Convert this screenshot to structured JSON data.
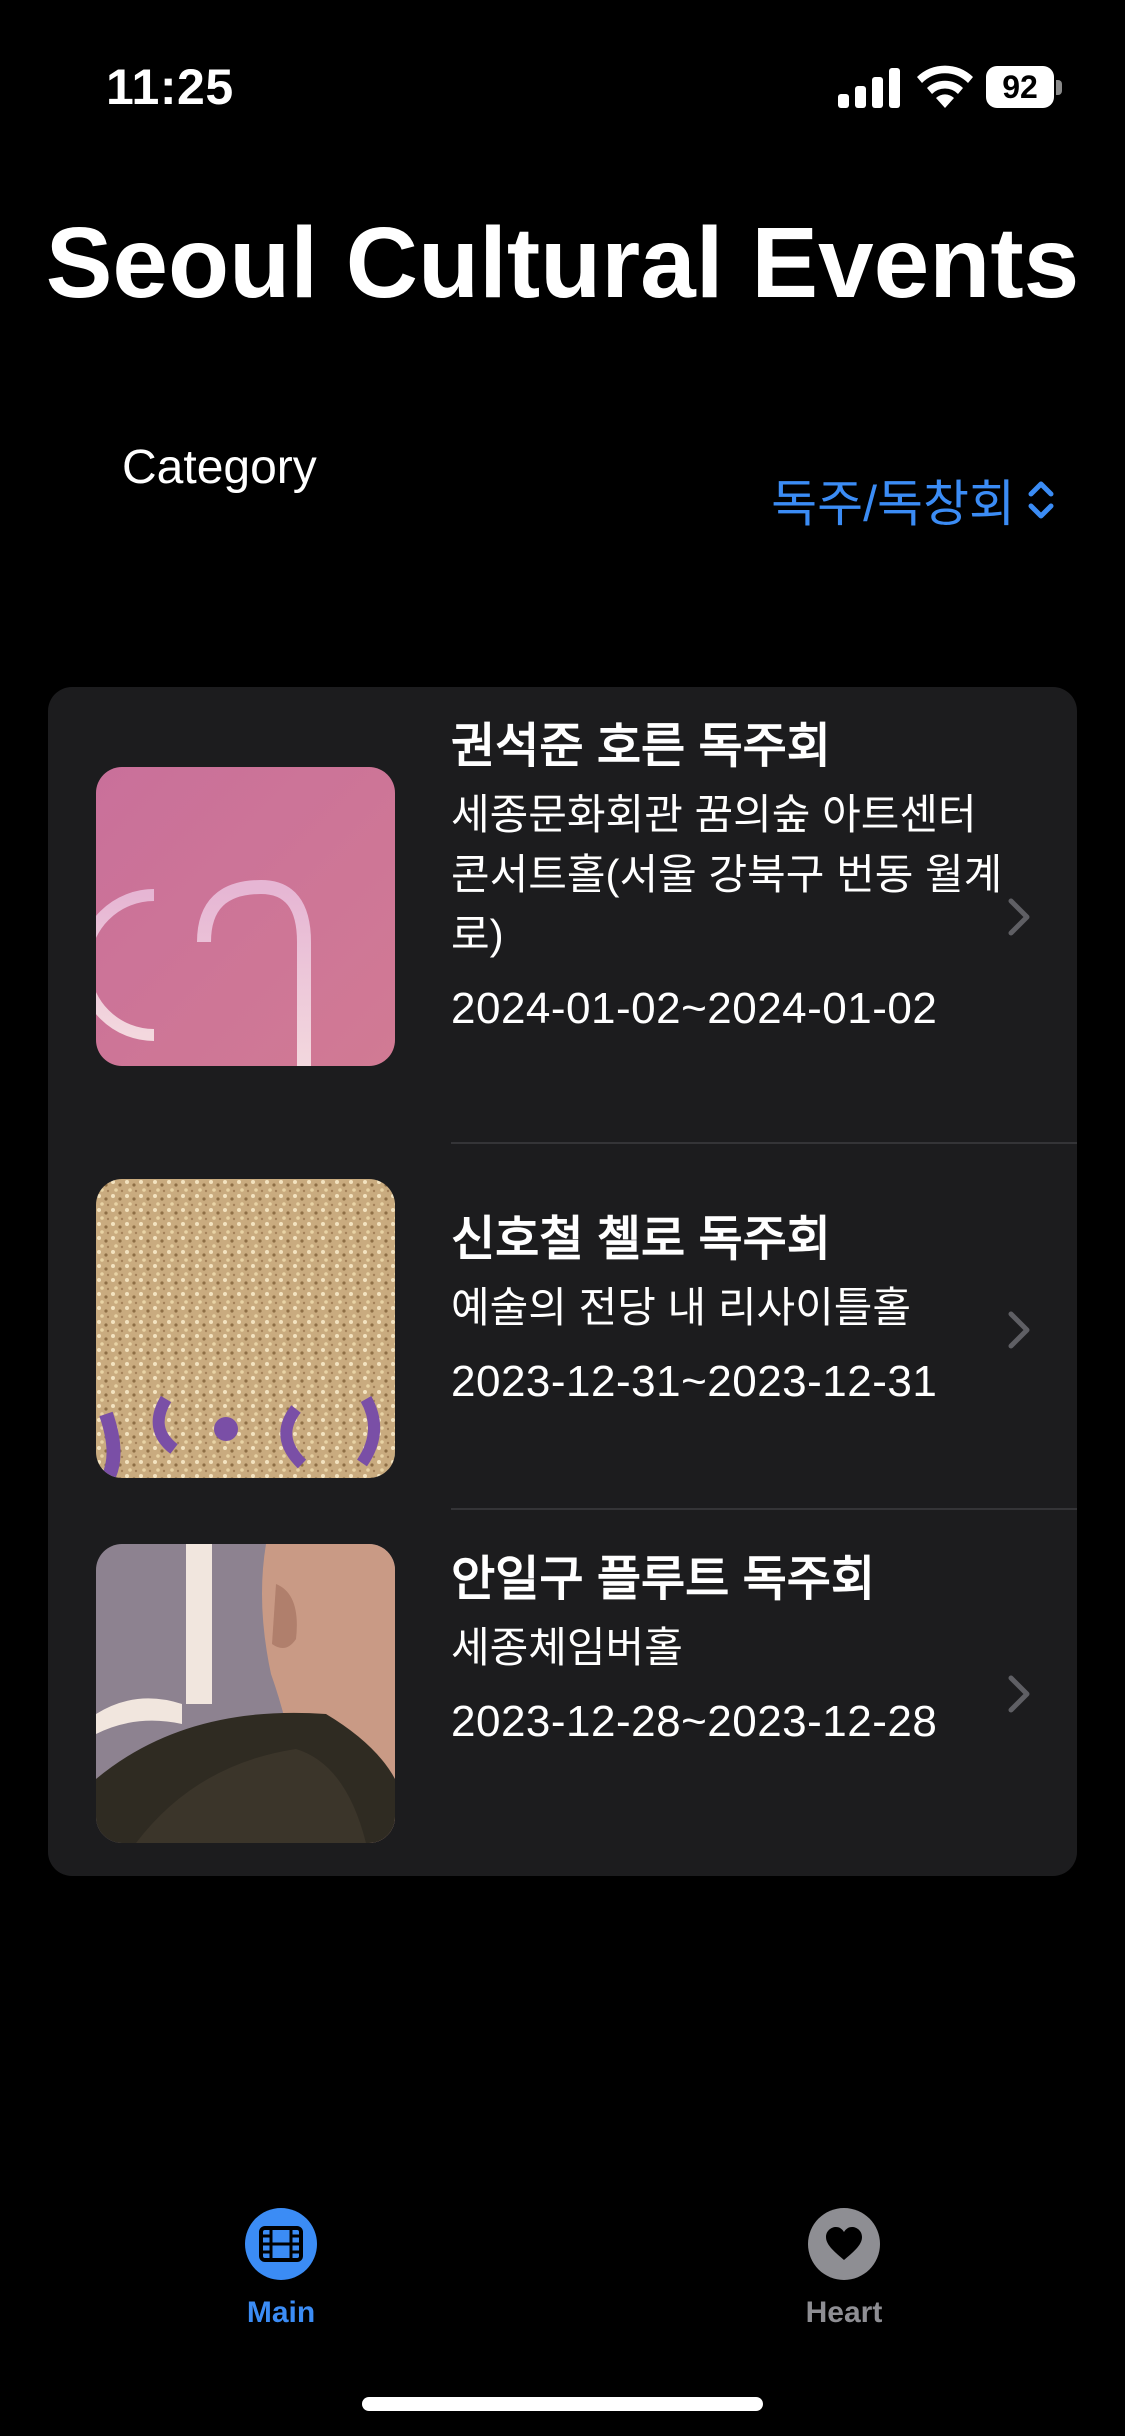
{
  "status_bar": {
    "time": "11:25",
    "battery": "92"
  },
  "header": {
    "title": "Seoul Cultural Events"
  },
  "category": {
    "label": "Category",
    "selected": "독주/독창회"
  },
  "events": [
    {
      "title": "권석준 호른 독주회",
      "venue": "세종문화회관 꿈의숲 아트센터 콘서트홀(서울 강북구 번동 월계로)",
      "date": "2024-01-02~2024-01-02",
      "thumb_icon": "poster-pink-thumbnail"
    },
    {
      "title": "신호철 첼로 독주회",
      "venue": "예술의 전당 내 리사이틀홀",
      "date": "2023-12-31~2023-12-31",
      "thumb_icon": "poster-glitter-thumbnail"
    },
    {
      "title": "안일구 플루트 독주회",
      "venue": "세종체임버홀",
      "date": "2023-12-28~2023-12-28",
      "thumb_icon": "poster-portrait-thumbnail"
    }
  ],
  "tab_bar": {
    "tabs": [
      {
        "label": "Main",
        "icon": "film-icon",
        "active": true
      },
      {
        "label": "Heart",
        "icon": "heart-icon",
        "active": false
      }
    ]
  },
  "colors": {
    "accent": "#3b8cf5",
    "inactive": "#8e8e93",
    "list_background": "#1c1c1e"
  }
}
